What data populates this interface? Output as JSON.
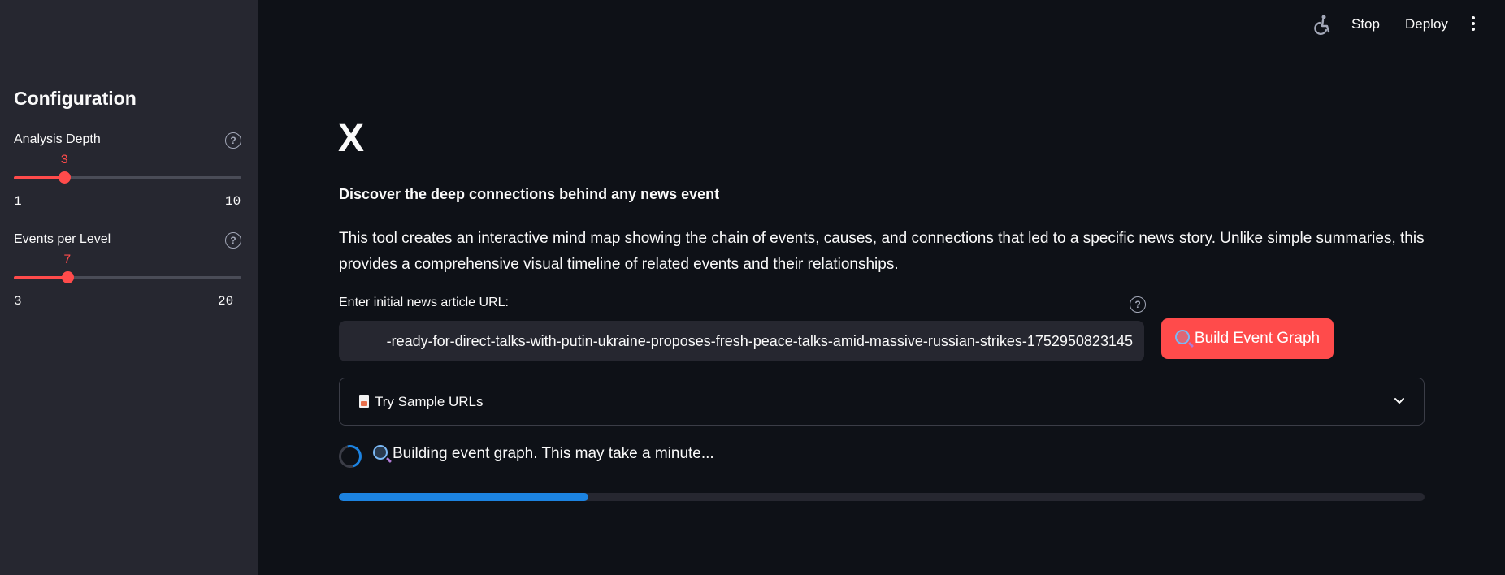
{
  "sidebar": {
    "title": "Configuration",
    "sliders": [
      {
        "label": "Analysis Depth",
        "value": "3",
        "min": "1",
        "max": "10",
        "fraction": 0.222
      },
      {
        "label": "Events per Level",
        "value": "7",
        "min": "3",
        "max": "20",
        "fraction": 0.235
      }
    ]
  },
  "header": {
    "stop_label": "Stop",
    "deploy_label": "Deploy"
  },
  "main": {
    "title": "X",
    "subtitle": "Discover the deep connections behind any news event",
    "description": "This tool creates an interactive mind map showing the chain of events, causes, and connections that led to a specific news story. Unlike simple summaries, this provides a comprehensive visual timeline of related events and their relationships.",
    "url_label": "Enter initial news article URL:",
    "url_value": "-ready-for-direct-talks-with-putin-ukraine-proposes-fresh-peace-talks-amid-massive-russian-strikes-1752950823145",
    "build_button": "Build Event Graph",
    "expander_label": "Try Sample URLs",
    "status_text": "Building event graph. This may take a minute...",
    "progress_fraction": 0.23
  },
  "colors": {
    "accent": "#ff4b4b",
    "progress": "#1c83e1",
    "background": "#0e1117",
    "sidebar": "#262730"
  }
}
